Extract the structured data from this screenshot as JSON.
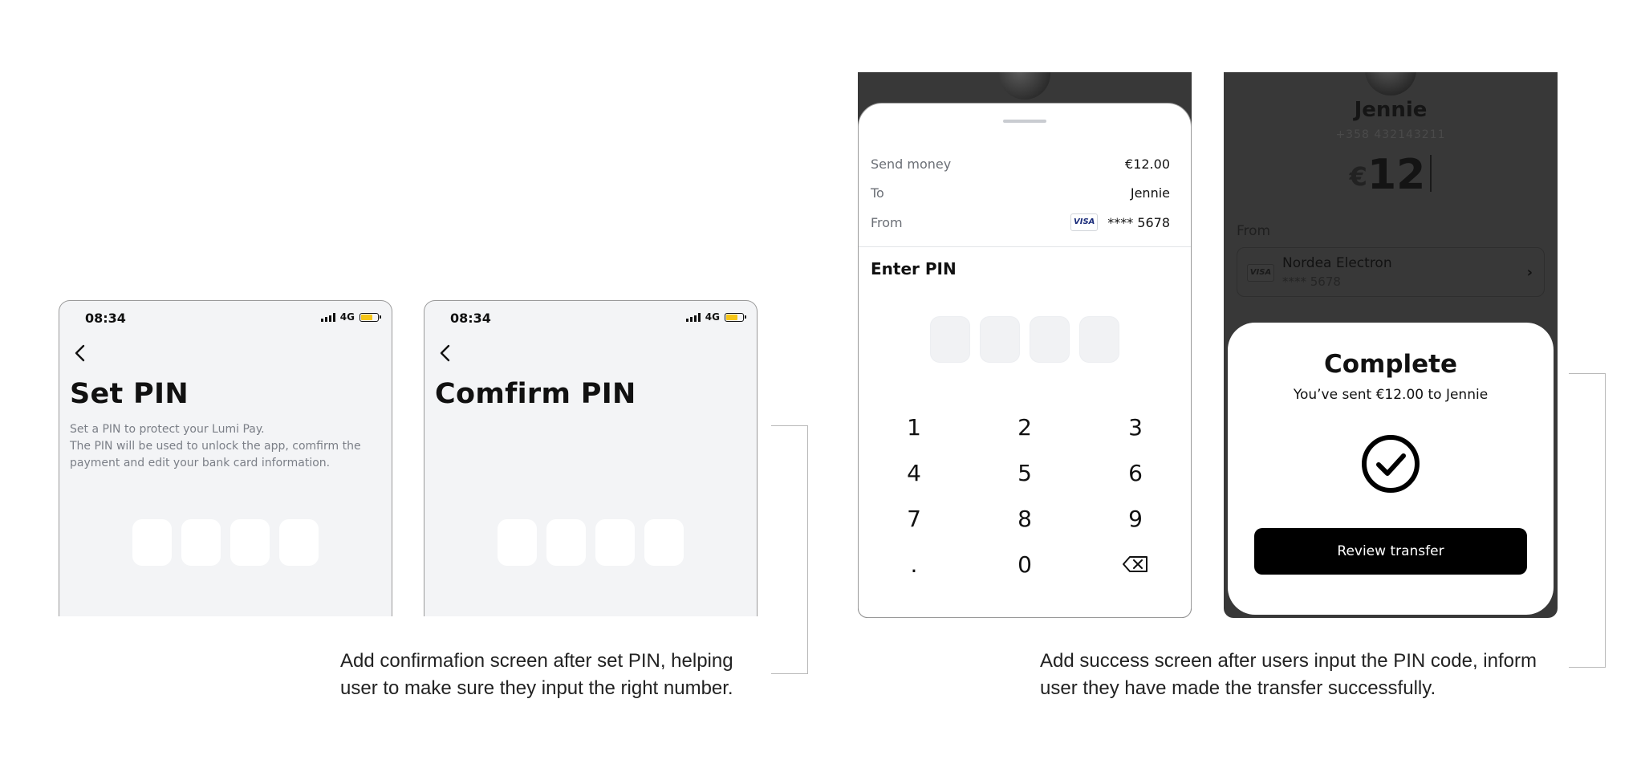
{
  "set_pin_screen": {
    "time": "08:34",
    "network": "4G",
    "title": "Set PIN",
    "description_line1": "Set a PIN to protect your Lumi Pay.",
    "description_line2": "The PIN will be used to unlock the app, comfirm the payment and edit your bank card information."
  },
  "confirm_pin_screen": {
    "time": "08:34",
    "network": "4G",
    "title": "Comfirm PIN"
  },
  "annotations": {
    "left_note": "Add confirmafion screen after set PIN, helping user to make sure they input the right number.",
    "right_note": "Add success screen after users input the PIN code, inform user they have made the transfer successfully."
  },
  "payment_pin_screen": {
    "send_money_label": "Send money",
    "send_money_value": "€12.00",
    "to_label": "To",
    "to_value": "Jennie",
    "from_label": "From",
    "card_brand": "VISA",
    "from_value": "**** 5678",
    "enter_pin_label": "Enter PIN",
    "keys": [
      "1",
      "2",
      "3",
      "4",
      "5",
      "6",
      "7",
      "8",
      "9",
      ".",
      "0"
    ]
  },
  "complete_screen": {
    "contact_name": "Jennie",
    "contact_phone": "+358 432143211",
    "currency_symbol": "€",
    "amount": "12",
    "from_label": "From",
    "card_brand": "VISA",
    "card_name": "Nordea Electron",
    "card_number": "**** 5678",
    "title": "Complete",
    "subtitle": "You’ve sent €12.00 to Jennie",
    "review_button": "Review transfer"
  },
  "colors": {
    "screen_bg": "#f3f4f6",
    "overlay_bg": "#383838",
    "battery": "#f5c518",
    "primary_button": "#000000"
  }
}
